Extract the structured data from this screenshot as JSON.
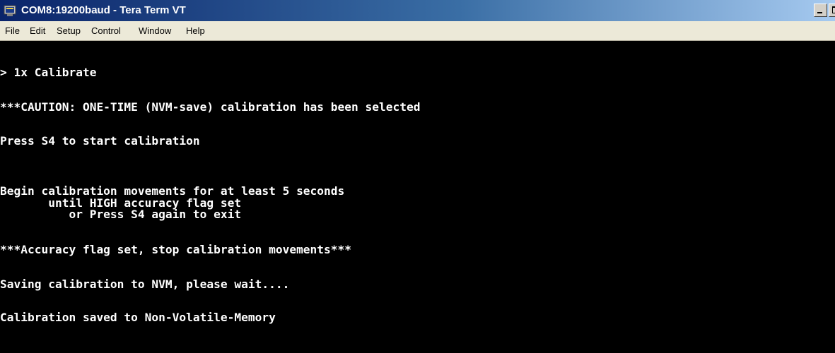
{
  "window": {
    "title": "COM8:19200baud - Tera Term VT",
    "icon": "tera-term-app-icon",
    "buttons": [
      "minimize",
      "restore"
    ]
  },
  "menu": {
    "file": "File",
    "edit": "Edit",
    "setup": "Setup",
    "control": "Control",
    "window": "Window",
    "help": "Help"
  },
  "terminal": {
    "lines": [
      "> 1x Calibrate",
      "***CAUTION: ONE-TIME (NVM-save) calibration has been selected",
      "Press S4 to start calibration",
      "Begin calibration movements for at least 5 seconds",
      "       until HIGH accuracy flag set",
      "          or Press S4 again to exit",
      "***Accuracy flag set, stop calibration movements***",
      "Saving calibration to NVM, please wait....",
      "Calibration saved to Non-Volatile-Memory"
    ]
  },
  "colors": {
    "titlebar_start": "#0a246a",
    "titlebar_end": "#a6caf0",
    "menubar_bg": "#ece9d8",
    "terminal_bg": "#000000",
    "terminal_fg": "#ffffff"
  }
}
